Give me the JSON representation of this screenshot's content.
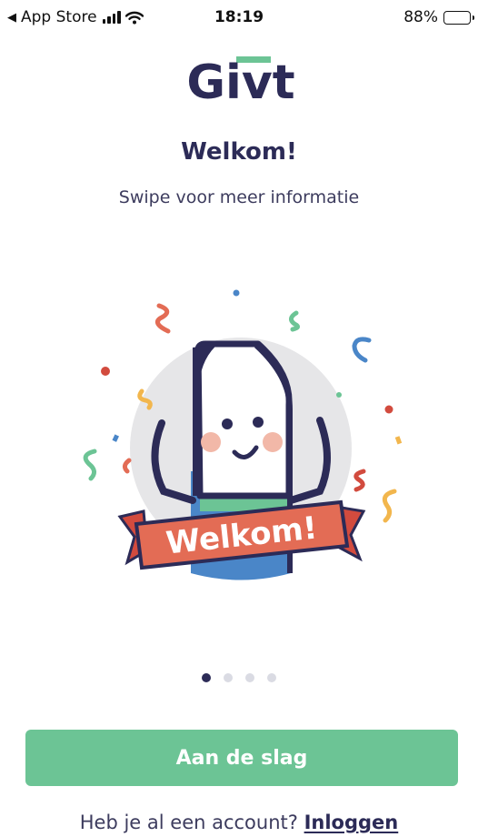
{
  "status_bar": {
    "back_label": "App Store",
    "back_icon": "triangle-left-icon",
    "time": "18:19",
    "battery_percent": "88%",
    "battery_level": 0.88
  },
  "logo": {
    "text": "Givt"
  },
  "welcome": {
    "title": "Welkom!",
    "subtitle": "Swipe voor meer informatie",
    "banner_text": "Welkom!"
  },
  "pager": {
    "total": 4,
    "active_index": 0
  },
  "actions": {
    "start_label": "Aan de slag",
    "login_prompt": "Heb je al een account? ",
    "login_link": "Inloggen"
  },
  "colors": {
    "primary_dark": "#2c2b57",
    "primary_green": "#6cc495",
    "banner_orange": "#e36c55",
    "confetti_yellow": "#f2b64d",
    "confetti_blue": "#4a86c8",
    "confetti_red": "#d24b3e"
  }
}
